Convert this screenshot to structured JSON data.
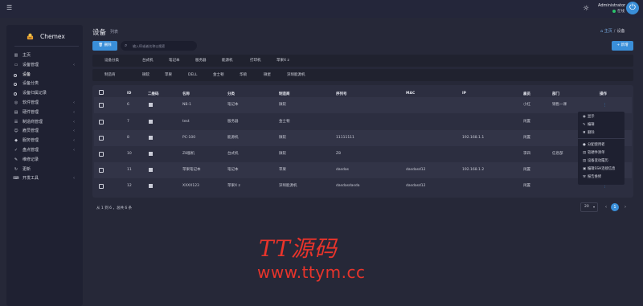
{
  "topbar": {
    "menu_icon": "hamburger-icon",
    "theme_icon": "sun-icon",
    "user_name": "Administrator",
    "user_status": "在线",
    "power_icon": "power-icon"
  },
  "sidebar": {
    "brand": "Chemex",
    "items": [
      {
        "label": "主页",
        "icon": "chart-icon",
        "chevron": false
      },
      {
        "label": "设备管理",
        "icon": "device-icon",
        "chevron": true
      },
      {
        "label": "设备",
        "icon": "ring-icon",
        "chevron": false,
        "sub": true,
        "active": true
      },
      {
        "label": "设备分类",
        "icon": "ring-icon",
        "chevron": false,
        "sub": true
      },
      {
        "label": "设备归属记录",
        "icon": "ring-icon",
        "chevron": false,
        "sub": true
      },
      {
        "label": "软件管理",
        "icon": "disk-icon",
        "chevron": true
      },
      {
        "label": "硬件管理",
        "icon": "box-icon",
        "chevron": true
      },
      {
        "label": "制造商管理",
        "icon": "list-icon",
        "chevron": true
      },
      {
        "label": "雇员管理",
        "icon": "users-icon",
        "chevron": true
      },
      {
        "label": "服务管理",
        "icon": "service-icon",
        "chevron": true
      },
      {
        "label": "盘点管理",
        "icon": "check-icon",
        "chevron": true
      },
      {
        "label": "维修记录",
        "icon": "wrench-icon",
        "chevron": false
      },
      {
        "label": "更新",
        "icon": "refresh-icon",
        "chevron": false
      },
      {
        "label": "开发工具",
        "icon": "code-icon",
        "chevron": true
      }
    ]
  },
  "page": {
    "title": "设备",
    "subtitle": "列表",
    "breadcrumb_home": "主页",
    "breadcrumb_current": "设备"
  },
  "toolbar": {
    "delete_label": "删除",
    "search_placeholder": "输入ID或者名称以搜索",
    "new_label": "+ 新增"
  },
  "filters": {
    "category_label": "设备分类",
    "categories": [
      "台式机",
      "笔记本",
      "服务器",
      "能源机",
      "打印机",
      "苹果X z"
    ],
    "maker_label": "制造商",
    "makers": [
      "微软",
      "苹果",
      "DELL",
      "金士顿",
      "华硕",
      "微星",
      "深圳能源机"
    ]
  },
  "table": {
    "headers": [
      "ID",
      "二维码",
      "名称",
      "分类",
      "制造商",
      "序列号",
      "MAC",
      "IP",
      "雇员",
      "部门",
      "操作"
    ],
    "rows": [
      {
        "id": "6",
        "name": "NB-1",
        "category": "笔记本",
        "maker": "微软",
        "serial": "",
        "mac": "",
        "ip": "",
        "staff": "小红",
        "dept": "销售一课"
      },
      {
        "id": "7",
        "name": "test",
        "category": "服务器",
        "maker": "金士顿",
        "serial": "",
        "mac": "",
        "ip": "",
        "staff": "闲置",
        "dept": ""
      },
      {
        "id": "8",
        "name": "PC-100",
        "category": "能源机",
        "maker": "微软",
        "serial": "11111111",
        "mac": "",
        "ip": "192.168.1.1",
        "staff": "闲置",
        "dept": ""
      },
      {
        "id": "10",
        "name": "Z8服机",
        "category": "台式机",
        "maker": "微软",
        "serial": "Z8",
        "mac": "",
        "ip": "",
        "staff": "李四",
        "dept": "信息部"
      },
      {
        "id": "11",
        "name": "苹果笔记本",
        "category": "笔记本",
        "maker": "苹果",
        "serial": "dasdas",
        "mac": "dasdasd12",
        "ip": "192.168.1.2",
        "staff": "闲置",
        "dept": ""
      },
      {
        "id": "12",
        "name": "XXXX123",
        "category": "苹果X z",
        "maker": "深圳能源机",
        "serial": "dasdasdasda",
        "mac": "dasdasd12",
        "ip": "",
        "staff": "闲置",
        "dept": ""
      }
    ]
  },
  "action_menu": {
    "items": [
      {
        "label": "显示",
        "icon": "eye-icon"
      },
      {
        "label": "编辑",
        "icon": "edit-icon"
      },
      {
        "label": "删除",
        "icon": "trash-icon"
      },
      {
        "label": "分配使用者",
        "icon": "user-icon"
      },
      {
        "label": "软硬件清单",
        "icon": "doc-icon"
      },
      {
        "label": "设备变动履历",
        "icon": "doc-icon"
      },
      {
        "label": "编辑SSH连接信息",
        "icon": "terminal-icon"
      },
      {
        "label": "报告维修",
        "icon": "wrench-icon"
      }
    ]
  },
  "pagination": {
    "info": "从 1 到 6 ，总共 6 条",
    "page_size": "20",
    "current_page": "1",
    "prev": "‹",
    "next": "›"
  },
  "watermark": {
    "title": "TT源码",
    "url": "www.ttym.cc"
  },
  "colors": {
    "accent": "#3a8fd9",
    "background": "#262838",
    "sidebar": "#1f2132",
    "watermark": "#e8342b"
  }
}
